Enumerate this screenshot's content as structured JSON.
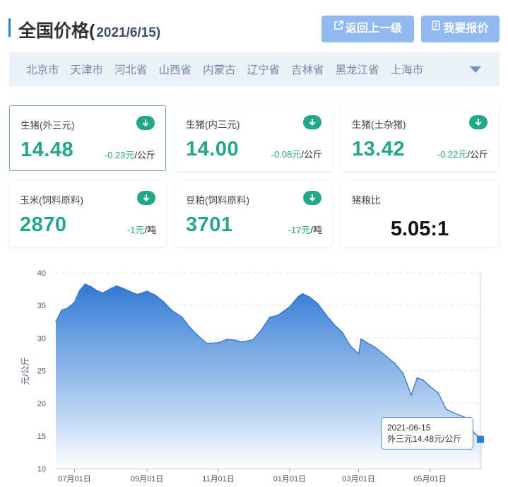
{
  "header": {
    "title": "全国价格(",
    "date": "2021/6/15)",
    "back_button": "返回上一级",
    "quote_button": "我要报价"
  },
  "provinces": [
    "北京市",
    "天津市",
    "河北省",
    "山西省",
    "内蒙古",
    "辽宁省",
    "吉林省",
    "黑龙江省",
    "上海市"
  ],
  "cards": [
    {
      "name": "生猪(外三元)",
      "price": "14.48",
      "change": "-0.23元",
      "unit": "/公斤",
      "trend": "down-icon"
    },
    {
      "name": "生猪(内三元)",
      "price": "14.00",
      "change": "-0.08元",
      "unit": "/公斤",
      "trend": "down-icon"
    },
    {
      "name": "生猪(土杂猪)",
      "price": "13.42",
      "change": "-0.22元",
      "unit": "/公斤",
      "trend": "down-icon"
    },
    {
      "name": "玉米(饲料原料)",
      "price": "2870",
      "change": "-1元",
      "unit": "/吨",
      "trend": "down-icon"
    },
    {
      "name": "豆粕(饲料原料)",
      "price": "3701",
      "change": "-17元",
      "unit": "/吨",
      "trend": "down-icon"
    },
    {
      "name": "猪粮比",
      "ratio": "5.05:1"
    }
  ],
  "colors": {
    "accent": "#2a7fd6",
    "button": "#8fb9ef",
    "down": "#23a68a",
    "province_bg": "#eaf1f9",
    "area_top": "#2f78d4",
    "area_bottom": "#ffffff"
  },
  "tooltip": {
    "date": "2021-06-15",
    "text": "外三元14.48元/公斤"
  },
  "chart_data": {
    "type": "area",
    "ylabel": "元/公斤",
    "ylim": [
      10,
      40
    ],
    "yticks": [
      10,
      15,
      20,
      25,
      30,
      35,
      40
    ],
    "xticks": [
      "07月01日",
      "09月01日",
      "11月01日",
      "01月01日",
      "03月01日",
      "05月01日"
    ],
    "xlim": [
      "2020-06-15",
      "2021-06-15"
    ],
    "grid": true,
    "series": [
      {
        "values": [
          [
            "2020-06-15",
            32.5
          ],
          [
            "2020-06-20",
            34.3
          ],
          [
            "2020-06-25",
            34.6
          ],
          [
            "2020-07-01",
            35.5
          ],
          [
            "2020-07-05",
            37.2
          ],
          [
            "2020-07-10",
            38.3
          ],
          [
            "2020-07-15",
            37.9
          ],
          [
            "2020-07-20",
            37.3
          ],
          [
            "2020-07-25",
            36.9
          ],
          [
            "2020-08-01",
            37.6
          ],
          [
            "2020-08-06",
            38.0
          ],
          [
            "2020-08-12",
            37.6
          ],
          [
            "2020-08-18",
            37.1
          ],
          [
            "2020-08-24",
            36.7
          ],
          [
            "2020-09-01",
            37.2
          ],
          [
            "2020-09-08",
            36.6
          ],
          [
            "2020-09-15",
            35.6
          ],
          [
            "2020-09-22",
            34.3
          ],
          [
            "2020-10-01",
            33.2
          ],
          [
            "2020-10-08",
            31.6
          ],
          [
            "2020-10-15",
            30.3
          ],
          [
            "2020-10-22",
            29.2
          ],
          [
            "2020-11-01",
            29.3
          ],
          [
            "2020-11-08",
            29.8
          ],
          [
            "2020-11-15",
            29.7
          ],
          [
            "2020-11-22",
            29.4
          ],
          [
            "2020-12-01",
            29.8
          ],
          [
            "2020-12-08",
            31.3
          ],
          [
            "2020-12-15",
            33.2
          ],
          [
            "2020-12-22",
            33.5
          ],
          [
            "2021-01-01",
            34.8
          ],
          [
            "2021-01-08",
            36.3
          ],
          [
            "2021-01-12",
            36.8
          ],
          [
            "2021-01-18",
            36.3
          ],
          [
            "2021-01-25",
            35.3
          ],
          [
            "2021-02-01",
            33.6
          ],
          [
            "2021-02-08",
            32.1
          ],
          [
            "2021-02-15",
            30.9
          ],
          [
            "2021-02-22",
            28.8
          ],
          [
            "2021-03-01",
            27.6
          ],
          [
            "2021-03-03",
            29.9
          ],
          [
            "2021-03-08",
            29.3
          ],
          [
            "2021-03-15",
            28.6
          ],
          [
            "2021-03-22",
            27.6
          ],
          [
            "2021-04-01",
            26.1
          ],
          [
            "2021-04-08",
            24.6
          ],
          [
            "2021-04-15",
            21.3
          ],
          [
            "2021-04-20",
            23.9
          ],
          [
            "2021-04-25",
            23.6
          ],
          [
            "2021-05-01",
            22.6
          ],
          [
            "2021-05-08",
            21.6
          ],
          [
            "2021-05-15",
            19.1
          ],
          [
            "2021-05-22",
            18.5
          ],
          [
            "2021-06-01",
            17.8
          ],
          [
            "2021-06-08",
            15.4
          ],
          [
            "2021-06-15",
            14.48
          ]
        ]
      }
    ]
  }
}
